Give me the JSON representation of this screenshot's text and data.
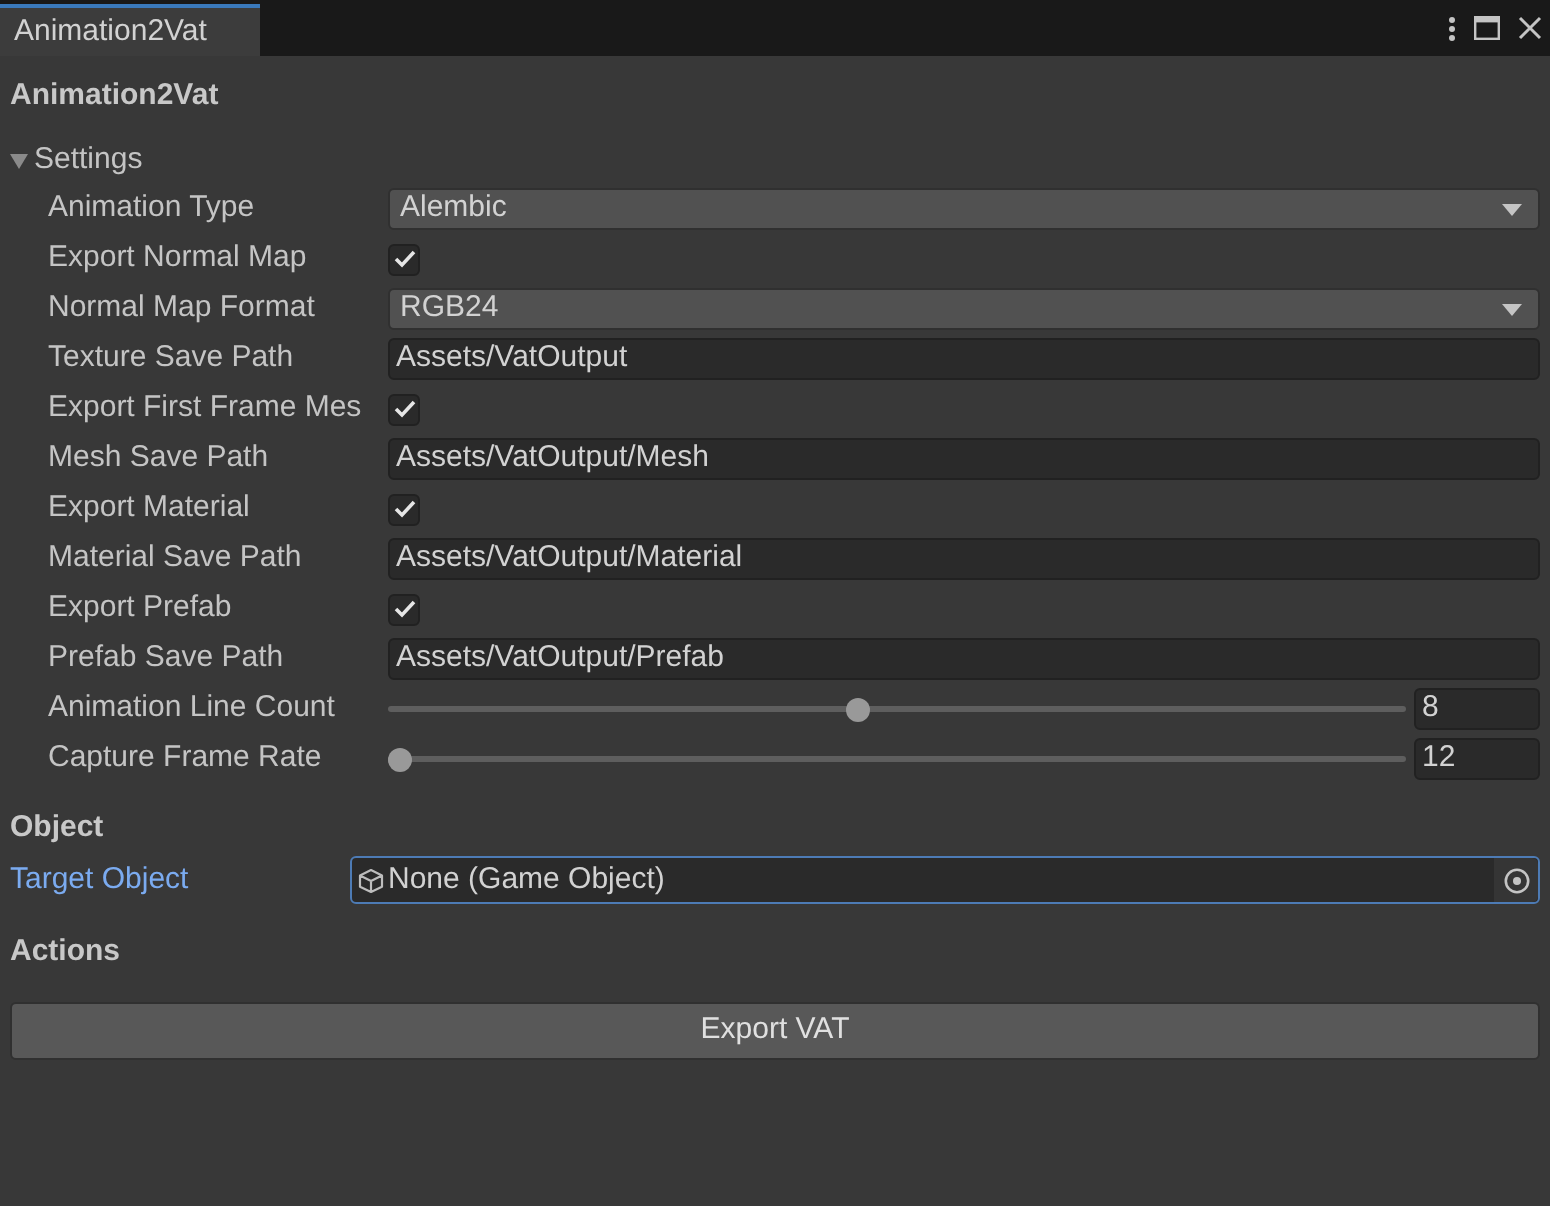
{
  "tab": {
    "label": "Animation2Vat"
  },
  "title": "Animation2Vat",
  "settings": {
    "label": "Settings",
    "expanded": true,
    "fields": [
      {
        "kind": "dropdown",
        "label": "Animation Type",
        "value": "Alembic"
      },
      {
        "kind": "checkbox",
        "label": "Export Normal Map",
        "checked": true
      },
      {
        "kind": "dropdown",
        "label": "Normal Map Format",
        "value": "RGB24"
      },
      {
        "kind": "text",
        "label": "Texture Save Path",
        "value": "Assets/VatOutput"
      },
      {
        "kind": "checkbox",
        "label": "Export First Frame Mes",
        "checked": true
      },
      {
        "kind": "text",
        "label": "Mesh Save Path",
        "value": "Assets/VatOutput/Mesh"
      },
      {
        "kind": "checkbox",
        "label": "Export Material",
        "checked": true
      },
      {
        "kind": "text",
        "label": "Material Save Path",
        "value": "Assets/VatOutput/Material"
      },
      {
        "kind": "checkbox",
        "label": "Export Prefab",
        "checked": true
      },
      {
        "kind": "text",
        "label": "Prefab Save Path",
        "value": "Assets/VatOutput/Prefab"
      },
      {
        "kind": "slider",
        "label": "Animation Line Count",
        "level": 0.46,
        "value": "8"
      },
      {
        "kind": "slider",
        "label": "Capture Frame Rate",
        "level": 0,
        "value": "12"
      }
    ]
  },
  "object": {
    "label": "Object",
    "fields": [
      {
        "kind": "object",
        "label": "Target Object",
        "value": "None (Game Object)",
        "focused": true
      }
    ]
  },
  "actions": {
    "label": "Actions",
    "buttons": [
      "Export VAT"
    ]
  }
}
